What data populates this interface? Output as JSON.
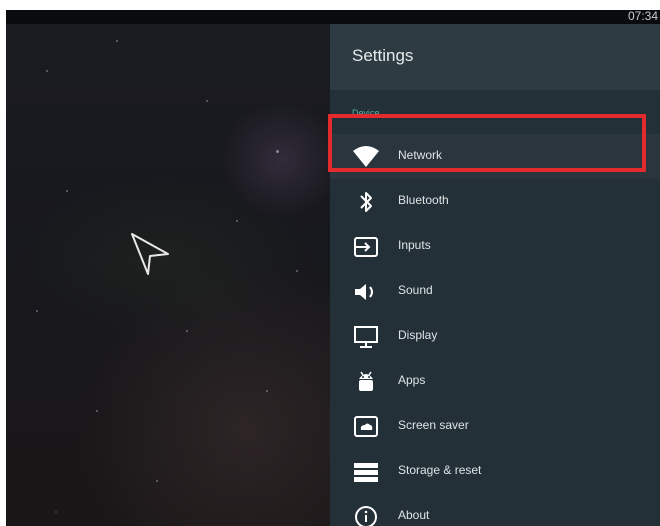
{
  "status_bar": {
    "time": "07:34"
  },
  "settings": {
    "title": "Settings",
    "section": "Device",
    "items": [
      {
        "label": "Network",
        "icon": "wifi-icon",
        "selected": true
      },
      {
        "label": "Bluetooth",
        "icon": "bluetooth-icon"
      },
      {
        "label": "Inputs",
        "icon": "input-icon"
      },
      {
        "label": "Sound",
        "icon": "speaker-icon"
      },
      {
        "label": "Display",
        "icon": "monitor-icon"
      },
      {
        "label": "Apps",
        "icon": "android-icon"
      },
      {
        "label": "Screen saver",
        "icon": "screensaver-icon"
      },
      {
        "label": "Storage & reset",
        "icon": "storage-icon"
      },
      {
        "label": "About",
        "icon": "info-icon"
      }
    ]
  },
  "highlight_color": "#e32a2e"
}
